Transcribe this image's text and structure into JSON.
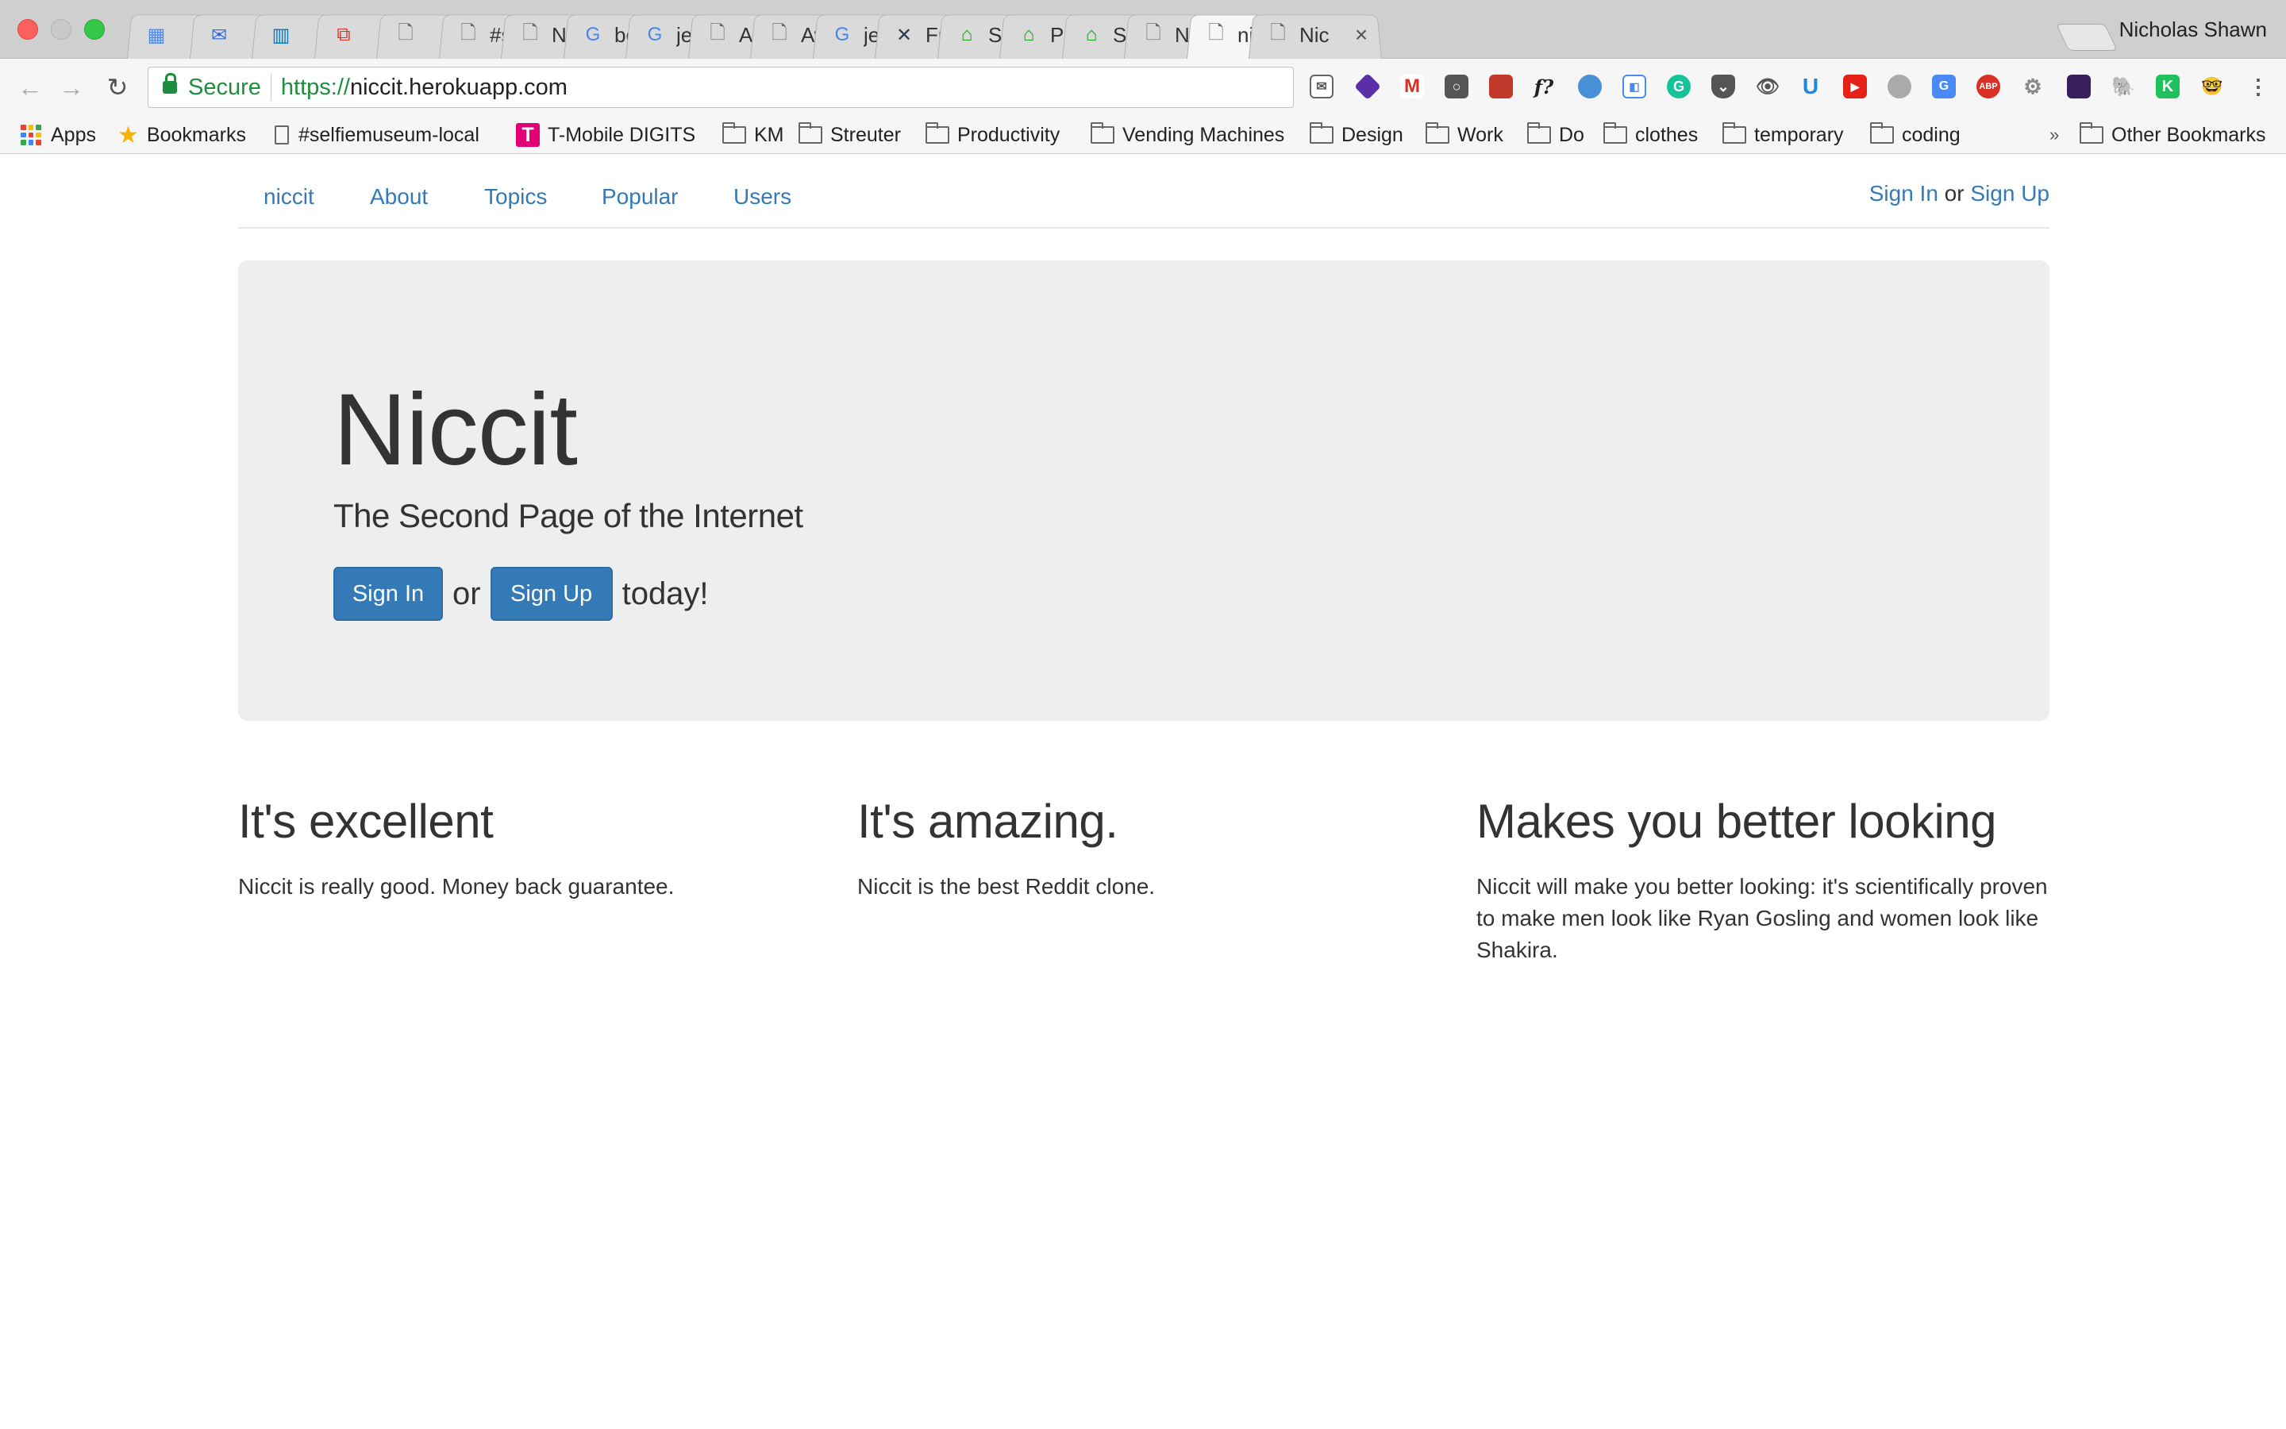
{
  "browser": {
    "profile_name": "Nicholas Shawn",
    "tabs": [
      {
        "title": "",
        "icon": "calendar-icon",
        "color": "#4a8af4"
      },
      {
        "title": "",
        "icon": "mail-icon",
        "color": "#3367d6"
      },
      {
        "title": "",
        "icon": "trello-icon",
        "color": "#0079bf"
      },
      {
        "title": "",
        "icon": "copy-icon",
        "color": "#d93025"
      },
      {
        "title": "",
        "icon": "page-icon",
        "color": "#666666"
      },
      {
        "title": "#se",
        "icon": "page-icon",
        "color": "#666666"
      },
      {
        "title": "Nic",
        "icon": "page-icon",
        "color": "#666666"
      },
      {
        "title": "boc",
        "icon": "google-icon",
        "color": "#4285f4"
      },
      {
        "title": "jeky",
        "icon": "google-icon",
        "color": "#4285f4"
      },
      {
        "title": "Age",
        "icon": "page-icon",
        "color": "#666666"
      },
      {
        "title": "Awe",
        "icon": "page-icon",
        "color": "#666666"
      },
      {
        "title": "jeky",
        "icon": "google-icon",
        "color": "#4285f4"
      },
      {
        "title": "Fre",
        "icon": "x-logo-icon",
        "color": "#2c3e50"
      },
      {
        "title": "Sm",
        "icon": "home-icon",
        "color": "#1a9e1a"
      },
      {
        "title": "Pho",
        "icon": "home-icon",
        "color": "#1a9e1a"
      },
      {
        "title": "Sm",
        "icon": "home-icon",
        "color": "#1a9e1a"
      },
      {
        "title": "Nic",
        "icon": "page-icon",
        "color": "#666666"
      },
      {
        "title": "nic",
        "icon": "page-icon",
        "color": "#666666",
        "active": true
      },
      {
        "title": "Nic",
        "icon": "page-icon",
        "color": "#666666"
      }
    ],
    "omnibox": {
      "secure_label": "Secure",
      "url_scheme": "https://",
      "url_host": "niccit.herokuapp.com"
    },
    "bookmarks": [
      {
        "label": "Apps",
        "icon": "apps-grid-icon"
      },
      {
        "label": "Bookmarks",
        "icon": "star-icon"
      },
      {
        "label": "#selfiemuseum-local",
        "icon": "page-icon"
      },
      {
        "label": "T-Mobile DIGITS",
        "icon": "tmobile-icon"
      },
      {
        "label": "KM",
        "icon": "folder-icon"
      },
      {
        "label": "Streuter",
        "icon": "folder-icon"
      },
      {
        "label": "Productivity",
        "icon": "folder-icon"
      },
      {
        "label": "Vending Machines",
        "icon": "folder-icon"
      },
      {
        "label": "Design",
        "icon": "folder-icon"
      },
      {
        "label": "Work",
        "icon": "folder-icon"
      },
      {
        "label": "Do",
        "icon": "folder-icon"
      },
      {
        "label": "clothes",
        "icon": "folder-icon"
      },
      {
        "label": "temporary",
        "icon": "folder-icon"
      },
      {
        "label": "coding",
        "icon": "folder-icon"
      }
    ],
    "bookmarks_overflow": "»",
    "other_bookmarks": "Other Bookmarks"
  },
  "site_nav": {
    "brand": "niccit",
    "links": [
      "About",
      "Topics",
      "Popular",
      "Users"
    ],
    "sign_in": "Sign In",
    "or": " or ",
    "sign_up": "Sign Up"
  },
  "hero": {
    "title": "Niccit",
    "subtitle": "The Second Page of the Internet",
    "sign_in_button": "Sign In",
    "or": "or",
    "sign_up_button": "Sign Up",
    "today": "today!"
  },
  "features": [
    {
      "heading": "It's excellent",
      "body": "Niccit is really good. Money back guarantee."
    },
    {
      "heading": "It's amazing.",
      "body": "Niccit is the best Reddit clone."
    },
    {
      "heading": "Makes you better looking",
      "body": "Niccit will make you better looking: it's scientifically proven to make men look like Ryan Gosling and women look like Shakira."
    }
  ],
  "colors": {
    "link": "#337ab7",
    "button": "#337ab7",
    "jumbotron_bg": "#eeeeee",
    "secure_green": "#1e8e3e"
  }
}
